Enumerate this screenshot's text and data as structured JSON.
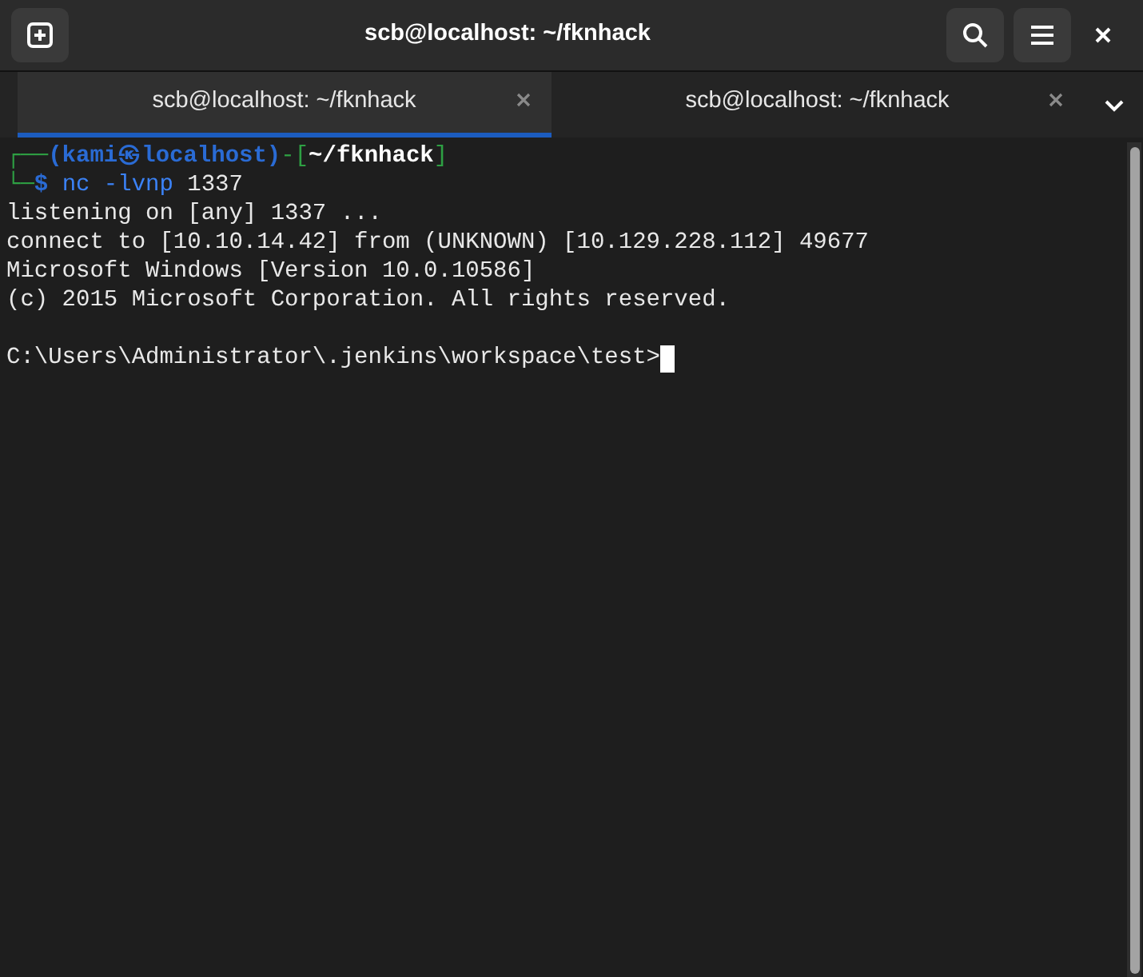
{
  "window": {
    "title": "scb@localhost: ~/fknhack"
  },
  "tabs": [
    {
      "label": "scb@localhost: ~/fknhack",
      "selected": true
    },
    {
      "label": "scb@localhost: ~/fknhack",
      "selected": false
    }
  ],
  "terminal": {
    "lines": [
      {
        "kind": "text",
        "segments": [
          {
            "text": "┌──",
            "kind": "frame"
          },
          {
            "text": "(kami㉿localhost)",
            "kind": "user"
          },
          {
            "text": "-[",
            "kind": "frame"
          },
          {
            "text": "~/fknhack",
            "kind": "path"
          },
          {
            "text": "]",
            "kind": "frame"
          }
        ]
      },
      {
        "kind": "text",
        "segments": [
          {
            "text": "└─",
            "kind": "frame"
          },
          {
            "text": "$ ",
            "kind": "user"
          },
          {
            "text": "nc -lvnp",
            "kind": "command"
          },
          {
            "text": " 1337",
            "kind": "plain"
          }
        ]
      },
      {
        "kind": "text",
        "segments": [
          {
            "text": "listening on [any] 1337 ...",
            "kind": "plain"
          }
        ]
      },
      {
        "kind": "text",
        "segments": [
          {
            "text": "connect to [10.10.14.42] from (UNKNOWN) [10.129.228.112] 49677",
            "kind": "plain"
          }
        ]
      },
      {
        "kind": "text",
        "segments": [
          {
            "text": "Microsoft Windows [Version 10.0.10586]",
            "kind": "plain"
          }
        ]
      },
      {
        "kind": "text",
        "segments": [
          {
            "text": "(c) 2015 Microsoft Corporation. All rights reserved.",
            "kind": "plain"
          }
        ]
      },
      {
        "kind": "blank"
      },
      {
        "kind": "text",
        "segments": [
          {
            "text": "C:\\Users\\Administrator\\.jenkins\\workspace\\test>",
            "kind": "plain"
          }
        ]
      }
    ]
  }
}
